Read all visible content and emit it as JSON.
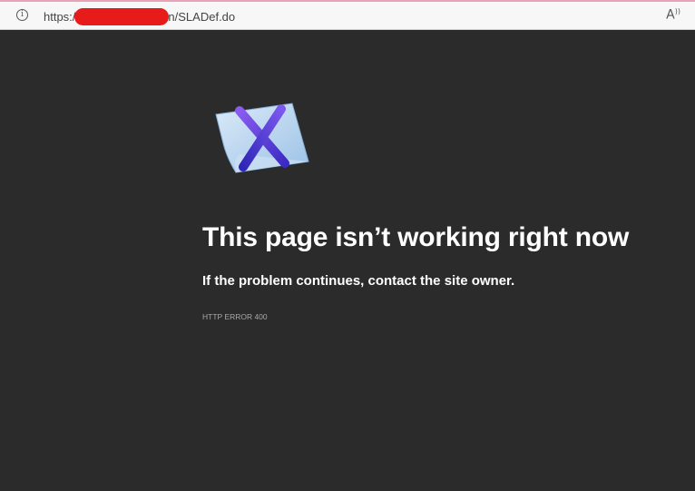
{
  "address_bar": {
    "url_prefix": "https:/",
    "url_suffix": "n/SLADef.do",
    "info_icon": "info-icon",
    "read_aloud_icon": "read-aloud-icon",
    "read_aloud_glyph": "A",
    "read_aloud_sup": "))"
  },
  "error": {
    "icon": "error-page-icon",
    "title": "This page isn’t working right now",
    "subtitle": "If the problem continues, contact the site owner.",
    "code": "HTTP ERROR 400"
  },
  "colors": {
    "page_background": "#2b2b2b",
    "redaction": "#e81b1b",
    "x_mark": "#5a3fd6",
    "paper": "#b9d6f0"
  }
}
